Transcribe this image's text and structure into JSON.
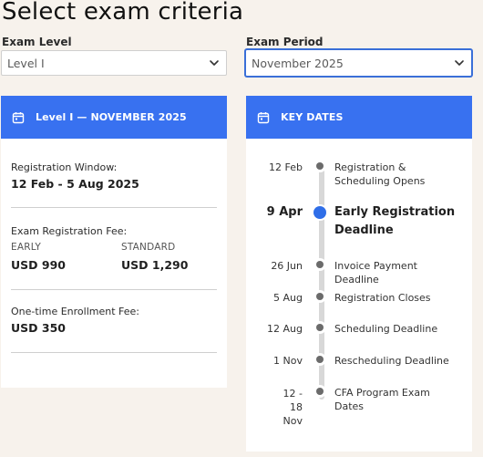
{
  "page": {
    "title": "Select exam criteria"
  },
  "filters": {
    "level": {
      "label": "Exam Level",
      "value": "Level I"
    },
    "period": {
      "label": "Exam Period",
      "value": "November 2025"
    }
  },
  "summary": {
    "header": "Level I — NOVEMBER 2025",
    "registration_window_label": "Registration Window:",
    "registration_window_value": "12 Feb - 5 Aug 2025",
    "fee_label": "Exam Registration Fee:",
    "early_label": "EARLY",
    "early_value": "USD 990",
    "standard_label": "STANDARD",
    "standard_value": "USD 1,290",
    "enrollment_label": "One-time Enrollment Fee:",
    "enrollment_value": "USD 350"
  },
  "key_dates": {
    "header": "KEY DATES",
    "items": [
      {
        "date": "12 Feb",
        "text": "Registration & Scheduling Opens"
      },
      {
        "date": "9 Apr",
        "text": "Early Registration Deadline"
      },
      {
        "date": "26 Jun",
        "text": "Invoice Payment Deadline"
      },
      {
        "date": "5 Aug",
        "text": "Registration Closes"
      },
      {
        "date": "12 Aug",
        "text": "Scheduling Deadline"
      },
      {
        "date": "1 Nov",
        "text": "Rescheduling Deadline"
      },
      {
        "date": "12 - 18 Nov",
        "text": "CFA Program Exam Dates"
      }
    ]
  },
  "colors": {
    "accent": "#3871f0",
    "page_bg": "#f7f2ec"
  }
}
